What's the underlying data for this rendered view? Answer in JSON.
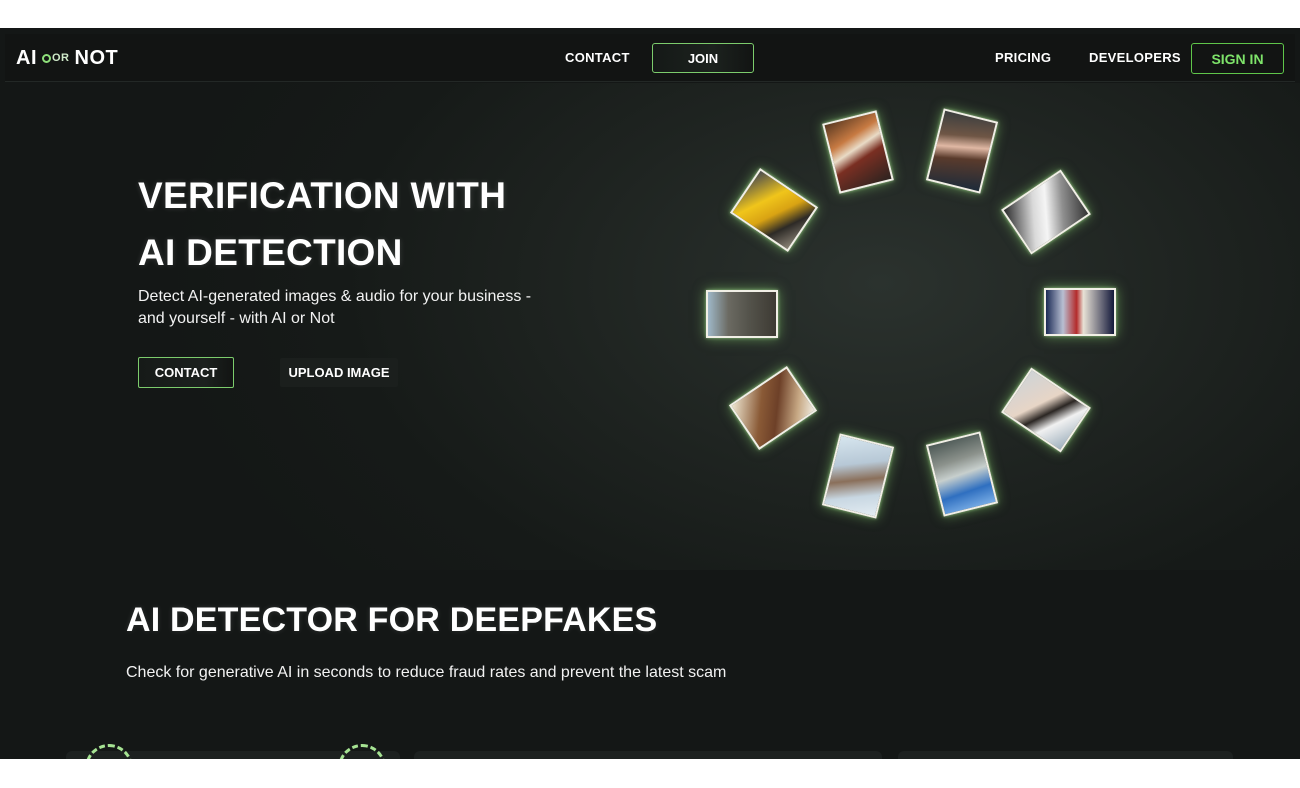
{
  "nav": {
    "logo": {
      "left": "AI",
      "mid": "OR",
      "right": "NOT"
    },
    "contact": "CONTACT",
    "join": "JOIN",
    "pricing": "PRICING",
    "developers": "DEVELOPERS",
    "sign_in": "SIGN IN"
  },
  "hero": {
    "title_line1": "VERIFICATION WITH",
    "title_line2": "AI DETECTION",
    "subtitle_line1": "Detect AI-generated images & audio for your business -",
    "subtitle_line2": "and yourself - with AI or Not",
    "contact_button": "CONTACT",
    "upload_button": "UPLOAD IMAGE"
  },
  "section2": {
    "title": "AI DETECTOR FOR DEEPFAKES",
    "subtitle": "Check for generative AI in seconds to reduce fraud rates and prevent the latest scam"
  },
  "colors": {
    "accent": "#7ee36a",
    "background": "#141716",
    "glow": "#96e678"
  }
}
